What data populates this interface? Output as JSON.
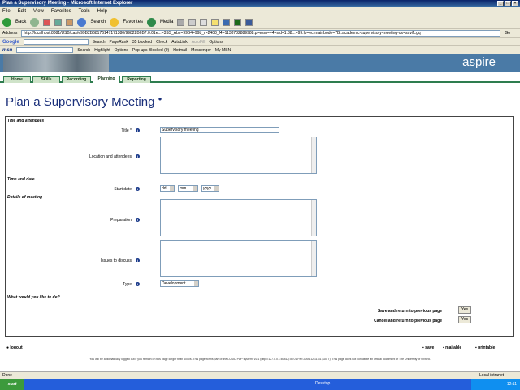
{
  "window": {
    "title": "Plan a Supervisory Meeting - Microsoft Internet Explorer"
  },
  "menu": [
    "File",
    "Edit",
    "View",
    "Favorites",
    "Tools",
    "Help"
  ],
  "toolbar": {
    "back": "Back",
    "search": "Search",
    "favorites": "Favorites",
    "media": "Media",
    "go": "Go"
  },
  "address": {
    "label": "Address",
    "url": "http://localhost:8081/USB/cas/e99B2B68176147171380/99822B6B7.0.01e...=3SS_Abc=99B4=99b_r=2408_f4=1138782889988.p=esm==4=sid=1.38...=99.lp=ec-mainbode=7B..academic-supervisory-meeting-ux=sav/k.gq"
  },
  "google_bar": {
    "brand": "Google",
    "search": "Search",
    "pagerank": "PageRank",
    "blocked": "35 blocked",
    "check": "Check",
    "autolink": "AutoLink",
    "autofill": "AutoFill",
    "options": "Options"
  },
  "msn_bar": {
    "brand": "msn",
    "search": "Search",
    "highlight": "Highlight",
    "options": "Options",
    "popup_blocked": "Pop-ups Blocked (0)",
    "hotmail": "Hotmail",
    "messenger": "Messenger",
    "mymsn": "My MSN"
  },
  "banner": {
    "logo": "aspire"
  },
  "tabs": [
    "Home",
    "Skills",
    "Recording",
    "Planning",
    "Reporting"
  ],
  "page": {
    "title": "Plan a Supervisory Meeting",
    "info_icon": "info-icon"
  },
  "form": {
    "sec_title": "Title and attendees",
    "title_label": "Title *",
    "title_value": "Supervisory meeting",
    "location_label": "Location and attendees",
    "sec_time": "Time and date",
    "start_label": "Start date",
    "dd": "dd",
    "mm": "mm",
    "yyyy": "yyyy",
    "sec_details": "Details of meeting",
    "prep_label": "Preparation",
    "issues_label": "Issues to discuss",
    "type_label": "Type",
    "type_value": "Development",
    "sec_action": "What would you like to do?",
    "save_label": "Save and return to previous page",
    "cancel_label": "Cancel and return to previous page",
    "yes": "Yes"
  },
  "footer": {
    "logout": "logout",
    "save": "save",
    "mailable": "mailable",
    "printable": "printable",
    "note": "You will be automatically logged out if you remain on this page longer than 6000s. This page forms part of the LUSID PDP system. v2.1 (http://127.0.0.1:8081/) on 01 Feb 2006 12:11:31 (GMT). This page does not constitute an official document of The University of Oxford."
  },
  "status": {
    "left": "Done",
    "zone": "Local intranet"
  },
  "taskbar": {
    "start": "start",
    "desktop": "Desktop",
    "time": "12:11"
  }
}
